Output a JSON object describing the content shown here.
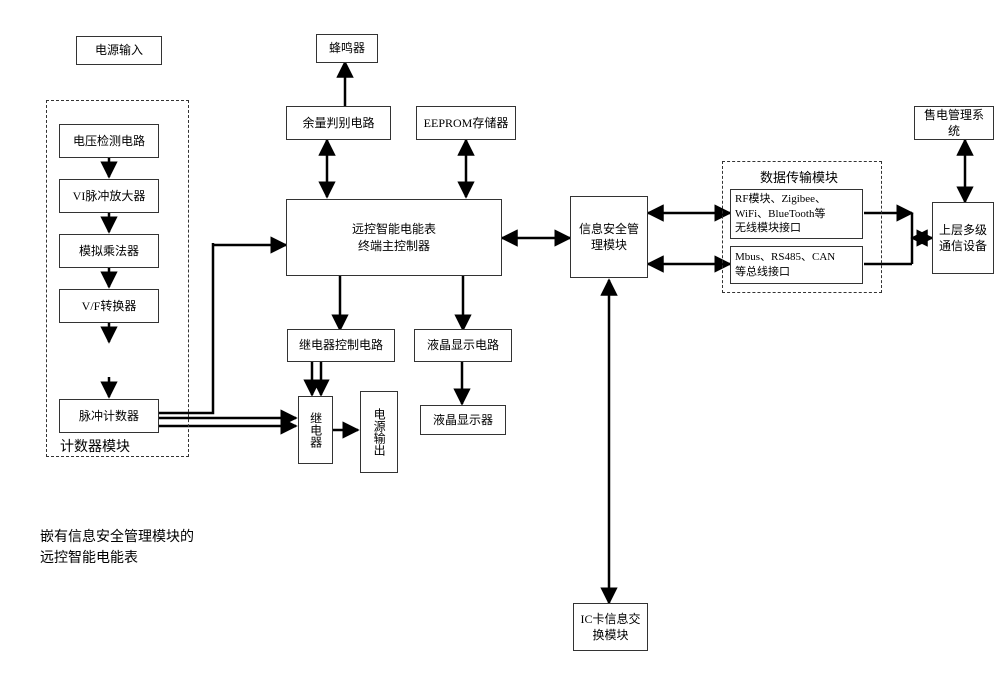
{
  "main_boundary_label_l1": "嵌有信息安全管理模块的",
  "main_boundary_label_l2": "远控智能电能表",
  "power_input": "电源输入",
  "counter_module_label": "计数器模块",
  "voltage_detect": "电压检测电路",
  "vi_pulse_amp": "VI脉冲放大器",
  "analog_mult": "模拟乘法器",
  "vf_converter": "V/F转换器",
  "pulse_counter": "脉冲计数器",
  "buzzer": "蜂鸣器",
  "remaining_judge": "余量判别电路",
  "eeprom": "EEPROM存储器",
  "main_controller_l1": "远控智能电能表",
  "main_controller_l2": "终端主控制器",
  "relay_control": "继电器控制电路",
  "lcd_circuit": "液晶显示电路",
  "relay": "继电器",
  "power_output": "电源输出",
  "lcd_display": "液晶显示器",
  "info_security": "信息安全管理模块",
  "data_transfer_label": "数据传输模块",
  "wireless_l1": "RF模块、Zigibee、",
  "wireless_l2": "WiFi、BlueTooth等",
  "wireless_l3": "无线模块接口",
  "bus_l1": "Mbus、RS485、CAN",
  "bus_l2": "等总线接口",
  "upper_comm": "上层多级通信设备",
  "sales_mgmt": "售电管理系统",
  "ic_card": "IC卡信息交换模块"
}
